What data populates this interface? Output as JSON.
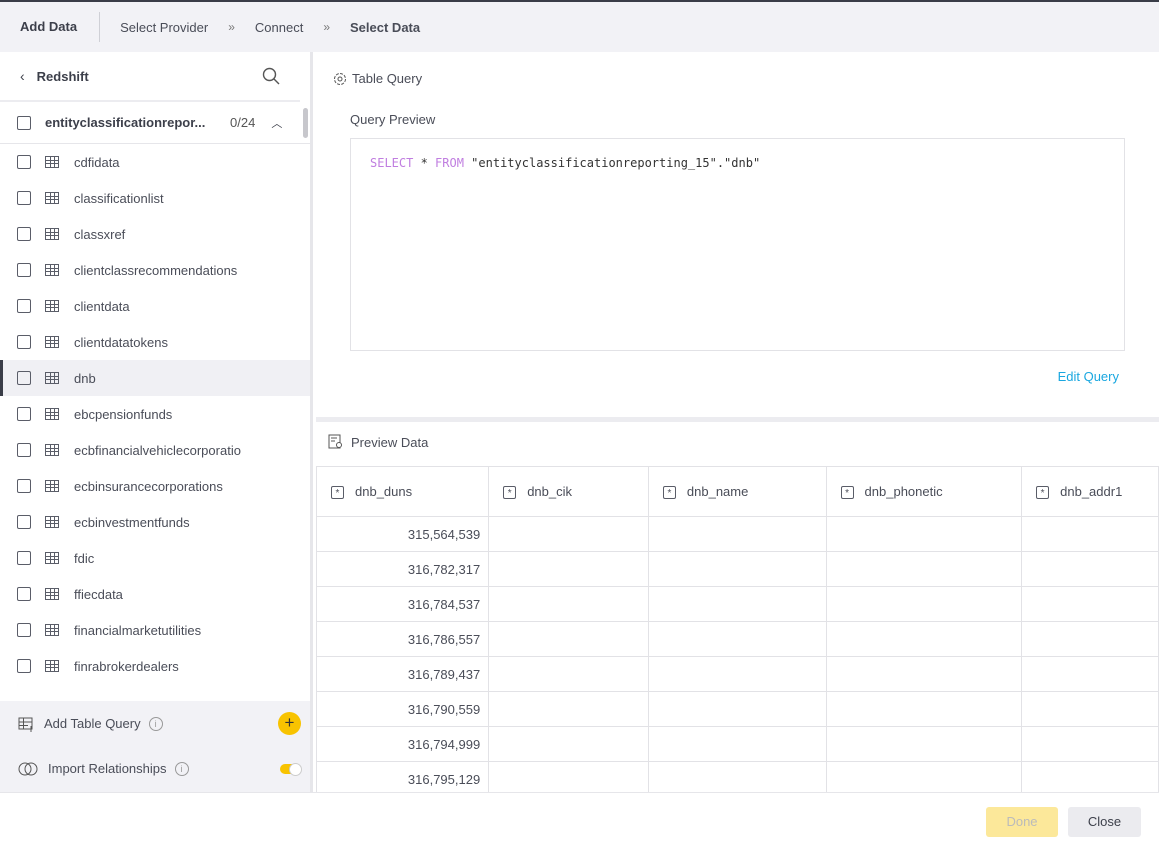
{
  "header": {
    "title": "Add Data",
    "steps": [
      "Select Provider",
      "Connect",
      "Select Data"
    ],
    "separator": "»"
  },
  "sidebar": {
    "source": "Redshift",
    "group": {
      "name": "entityclassificationreporting_15",
      "display_name": "entityclassificationrepor...",
      "count": "0/24"
    },
    "items": [
      "cdfidata",
      "classificationlist",
      "classxref",
      "clientclassrecommendations",
      "clientdata",
      "clientdatatokens",
      "dnb",
      "ebcpensionfunds",
      "ecbfinancialvehiclecorporatio",
      "ecbinsurancecorporations",
      "ecbinvestmentfunds",
      "fdic",
      "ffiecdata",
      "financialmarketutilities",
      "finrabrokerdealers"
    ],
    "selected": "dnb",
    "add_table_query": "Add Table Query",
    "import_relationships": "Import Relationships",
    "import_relationships_on": true
  },
  "query": {
    "section_title": "Table Query",
    "preview_label": "Query Preview",
    "kw_select": "SELECT",
    "star": " * ",
    "kw_from": "FROM",
    "rest": " \"entityclassificationreporting_15\".\"dnb\"",
    "edit_label": "Edit Query"
  },
  "preview": {
    "title": "Preview Data",
    "columns": [
      "dnb_duns",
      "dnb_cik",
      "dnb_name",
      "dnb_phonetic",
      "dnb_addr1"
    ],
    "rows": [
      "315,564,539",
      "316,782,317",
      "316,784,537",
      "316,786,557",
      "316,789,437",
      "316,790,559",
      "316,794,999",
      "316,795,129"
    ]
  },
  "footer": {
    "done": "Done",
    "close": "Close"
  },
  "colors": {
    "accent": "#f8c300",
    "link": "#1aa7e0",
    "keyword": "#c07ee0"
  }
}
